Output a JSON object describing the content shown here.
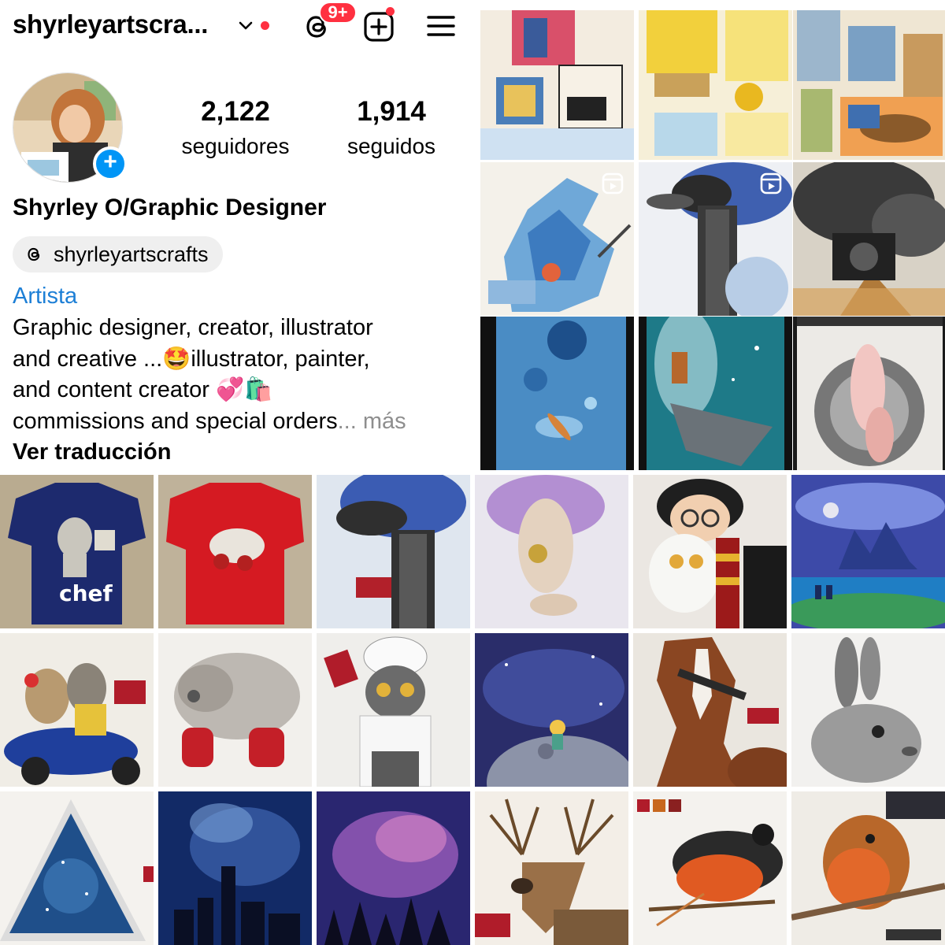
{
  "header": {
    "username": "shyrleyartscra...",
    "notification_badge": "9+",
    "accent_color": "#ff3040"
  },
  "profile": {
    "followers_count": "2,122",
    "followers_label": "seguidores",
    "following_count": "1,914",
    "following_label": "seguidos",
    "display_name": "Shyrley O/Graphic Designer",
    "threads_handle": "shyrleyartscrafts",
    "category": "Artista",
    "bio_lines": [
      "Graphic designer, creator, illustrator",
      "and creative ...🤩illustrator, painter,",
      "and content creator 💞🛍️",
      "commissions and special orders"
    ],
    "more_label": "... más",
    "translate_label": "Ver traducción",
    "link_color": "#1d7fd6",
    "plus_color": "#0095f6"
  },
  "icons": {
    "chevron": "chevron-down-icon",
    "threads": "threads-icon",
    "add": "add-post-icon",
    "menu": "hamburger-menu-icon",
    "reel": "reel-icon"
  },
  "posts": {
    "top_right": [
      {
        "subject": "comic-school",
        "reel": false
      },
      {
        "subject": "comic-yellow",
        "reel": false
      },
      {
        "subject": "comic-city-guitar",
        "reel": false
      },
      {
        "subject": "dragon",
        "reel": true
      },
      {
        "subject": "goose",
        "reel": true
      },
      {
        "subject": "train",
        "reel": false
      },
      {
        "subject": "kayak-water",
        "reel": false
      },
      {
        "subject": "manta-ray",
        "reel": false
      },
      {
        "subject": "ballet-shoes",
        "reel": false
      }
    ],
    "bottom_left": [
      {
        "subject": "chef-tshirt-blue",
        "reel": false
      },
      {
        "subject": "pig-tshirt-red",
        "reel": false
      },
      {
        "subject": "goose-painting",
        "reel": false
      },
      {
        "subject": "animals-scooter",
        "reel": false
      },
      {
        "subject": "pig-boots",
        "reel": false
      },
      {
        "subject": "owl-chef",
        "reel": false
      },
      {
        "subject": "galaxy-triangle",
        "reel": false
      },
      {
        "subject": "galaxy-city",
        "reel": false
      },
      {
        "subject": "galaxy-forest",
        "reel": false
      }
    ],
    "bottom_right": [
      {
        "subject": "ballerina",
        "reel": false
      },
      {
        "subject": "wizard-owl",
        "reel": false
      },
      {
        "subject": "castle-night",
        "reel": false
      },
      {
        "subject": "little-prince",
        "reel": false
      },
      {
        "subject": "horse",
        "reel": false
      },
      {
        "subject": "rabbit-sketch",
        "reel": false
      },
      {
        "subject": "deer",
        "reel": false
      },
      {
        "subject": "oriole-bird",
        "reel": false
      },
      {
        "subject": "robin-bird",
        "reel": false
      }
    ]
  }
}
